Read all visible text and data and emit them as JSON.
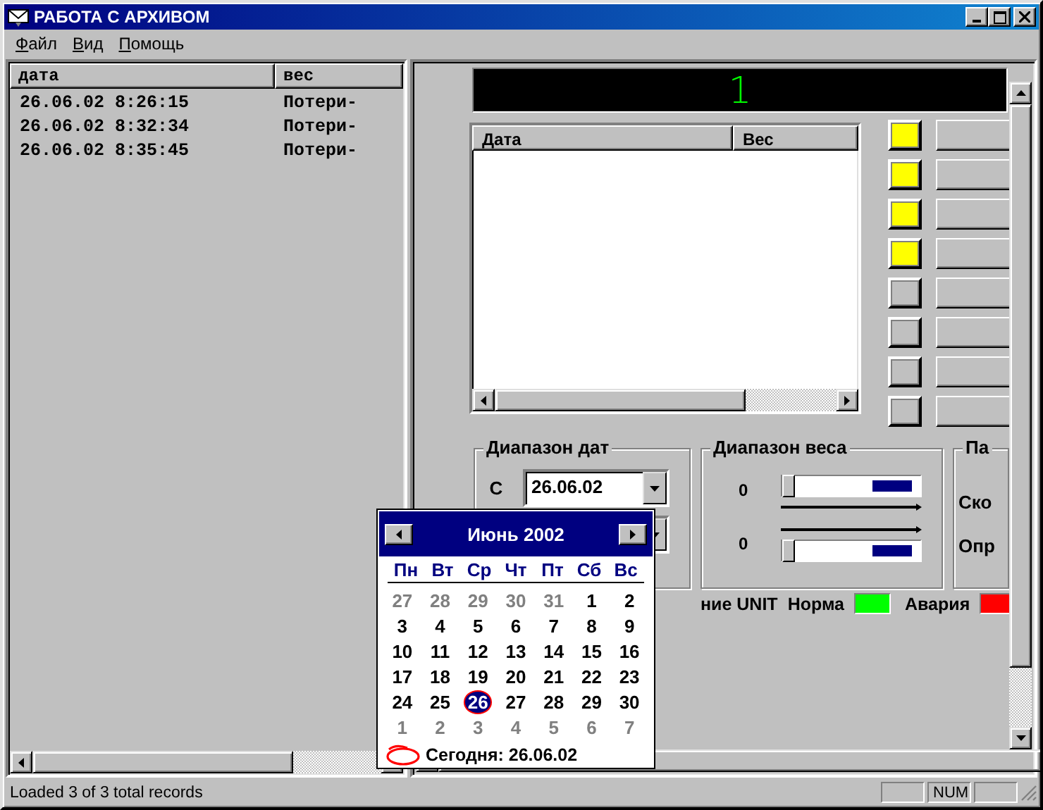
{
  "window": {
    "title": "РАБОТА С АРХИВОМ"
  },
  "menu": [
    "Файл",
    "Вид",
    "Помощь"
  ],
  "archive_list": {
    "columns": [
      "дата",
      "вес"
    ],
    "rows": [
      {
        "date": "26.06.02 8:26:15",
        "weight": "Потери-"
      },
      {
        "date": "26.06.02 8:32:34",
        "weight": "Потери-"
      },
      {
        "date": "26.06.02 8:35:45",
        "weight": "Потери-"
      }
    ]
  },
  "display": {
    "value": "1"
  },
  "detail_table": {
    "columns": [
      "Дата",
      "Вес"
    ]
  },
  "indicators": [
    {
      "on": true
    },
    {
      "on": true
    },
    {
      "on": true
    },
    {
      "on": true
    },
    {
      "on": false
    },
    {
      "on": false
    },
    {
      "on": false
    },
    {
      "on": false
    }
  ],
  "date_range": {
    "title": "Диапазон дат",
    "from_label": "С",
    "from_value": "26.06.02"
  },
  "weight_range": {
    "title": "Диапазон веса",
    "sliders": [
      {
        "reading": "0",
        "level": 0
      },
      {
        "reading": "0",
        "level": 0
      }
    ]
  },
  "params": {
    "title": "Па",
    "labels": [
      "Ско",
      "Опр"
    ]
  },
  "state_row": {
    "label": "ние UNIT",
    "lamps": [
      {
        "label": "Норма",
        "color": "#00ff00"
      },
      {
        "label": "Авария",
        "color": "#ff0000"
      }
    ]
  },
  "calendar": {
    "title": "Июнь 2002",
    "weekdays": [
      "Пн",
      "Вт",
      "Ср",
      "Чт",
      "Пт",
      "Сб",
      "Вс"
    ],
    "weeks": [
      [
        {
          "day": "27",
          "other": true,
          "selected": false
        },
        {
          "day": "28",
          "other": true,
          "selected": false
        },
        {
          "day": "29",
          "other": true,
          "selected": false
        },
        {
          "day": "30",
          "other": true,
          "selected": false
        },
        {
          "day": "31",
          "other": true,
          "selected": false
        },
        {
          "day": "1",
          "other": false,
          "selected": false
        },
        {
          "day": "2",
          "other": false,
          "selected": false
        }
      ],
      [
        {
          "day": "3",
          "other": false,
          "selected": false
        },
        {
          "day": "4",
          "other": false,
          "selected": false
        },
        {
          "day": "5",
          "other": false,
          "selected": false
        },
        {
          "day": "6",
          "other": false,
          "selected": false
        },
        {
          "day": "7",
          "other": false,
          "selected": false
        },
        {
          "day": "8",
          "other": false,
          "selected": false
        },
        {
          "day": "9",
          "other": false,
          "selected": false
        }
      ],
      [
        {
          "day": "10",
          "other": false,
          "selected": false
        },
        {
          "day": "11",
          "other": false,
          "selected": false
        },
        {
          "day": "12",
          "other": false,
          "selected": false
        },
        {
          "day": "13",
          "other": false,
          "selected": false
        },
        {
          "day": "14",
          "other": false,
          "selected": false
        },
        {
          "day": "15",
          "other": false,
          "selected": false
        },
        {
          "day": "16",
          "other": false,
          "selected": false
        }
      ],
      [
        {
          "day": "17",
          "other": false,
          "selected": false
        },
        {
          "day": "18",
          "other": false,
          "selected": false
        },
        {
          "day": "19",
          "other": false,
          "selected": false
        },
        {
          "day": "20",
          "other": false,
          "selected": false
        },
        {
          "day": "21",
          "other": false,
          "selected": false
        },
        {
          "day": "22",
          "other": false,
          "selected": false
        },
        {
          "day": "23",
          "other": false,
          "selected": false
        }
      ],
      [
        {
          "day": "24",
          "other": false,
          "selected": false
        },
        {
          "day": "25",
          "other": false,
          "selected": false
        },
        {
          "day": "26",
          "other": false,
          "selected": true
        },
        {
          "day": "27",
          "other": false,
          "selected": false
        },
        {
          "day": "28",
          "other": false,
          "selected": false
        },
        {
          "day": "29",
          "other": false,
          "selected": false
        },
        {
          "day": "30",
          "other": false,
          "selected": false
        }
      ],
      [
        {
          "day": "1",
          "other": true,
          "selected": false
        },
        {
          "day": "2",
          "other": true,
          "selected": false
        },
        {
          "day": "3",
          "other": true,
          "selected": false
        },
        {
          "day": "4",
          "other": true,
          "selected": false
        },
        {
          "day": "5",
          "other": true,
          "selected": false
        },
        {
          "day": "6",
          "other": true,
          "selected": false
        },
        {
          "day": "7",
          "other": true,
          "selected": false
        }
      ]
    ],
    "today": "Сегодня: 26.06.02"
  },
  "status_bar": {
    "text": "Loaded 3 of 3 total records",
    "indicator": "NUM"
  }
}
